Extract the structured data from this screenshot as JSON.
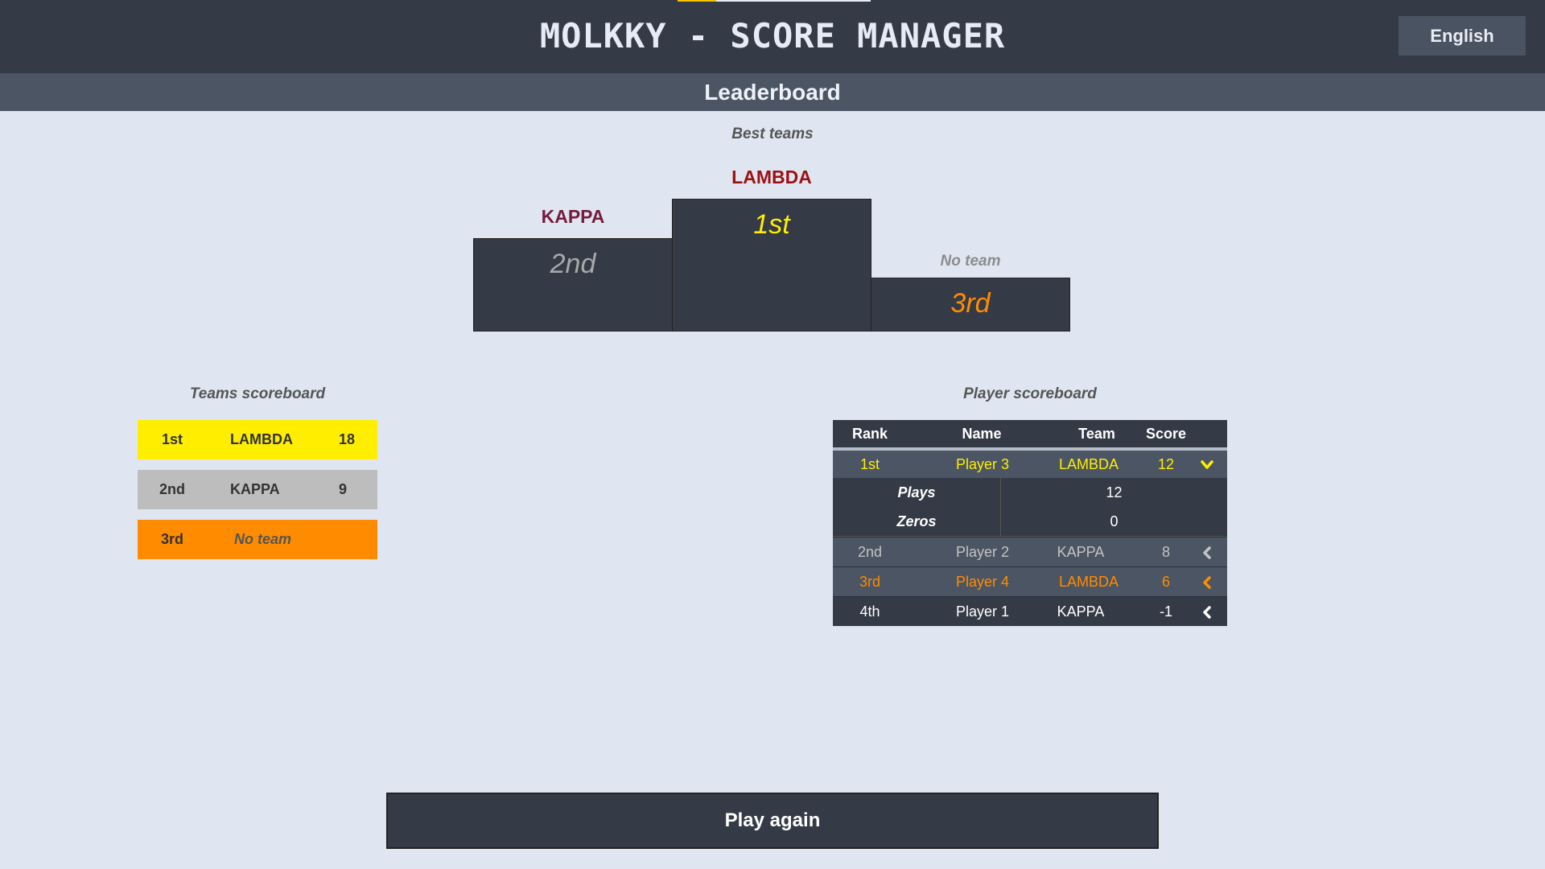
{
  "header": {
    "title": "MOLKKY - SCORE MANAGER",
    "language_label": "English"
  },
  "page": {
    "subtitle": "Leaderboard"
  },
  "podium": {
    "label": "Best teams",
    "first": {
      "team": "LAMBDA",
      "place": "1st"
    },
    "second": {
      "team": "KAPPA",
      "place": "2nd"
    },
    "third": {
      "team": "No team",
      "place": "3rd"
    }
  },
  "teams_scoreboard": {
    "label": "Teams scoreboard",
    "rows": [
      {
        "rank": "1st",
        "name": "LAMBDA",
        "score": "18"
      },
      {
        "rank": "2nd",
        "name": "KAPPA",
        "score": "9"
      },
      {
        "rank": "3rd",
        "name": "No team",
        "score": ""
      }
    ]
  },
  "player_scoreboard": {
    "label": "Player scoreboard",
    "columns": [
      "Rank",
      "Name",
      "Team",
      "Score"
    ],
    "rows": [
      {
        "rank": "1st",
        "name": "Player 3",
        "team": "LAMBDA",
        "score": "12",
        "expanded": true
      },
      {
        "rank": "2nd",
        "name": "Player 2",
        "team": "KAPPA",
        "score": "8",
        "expanded": false
      },
      {
        "rank": "3rd",
        "name": "Player 4",
        "team": "LAMBDA",
        "score": "6",
        "expanded": false
      },
      {
        "rank": "4th",
        "name": "Player 1",
        "team": "KAPPA",
        "score": "-1",
        "expanded": false
      }
    ],
    "details": {
      "plays_label": "Plays",
      "plays_value": "12",
      "zeros_label": "Zeros",
      "zeros_value": "0"
    }
  },
  "footer": {
    "play_again_label": "Play again"
  },
  "colors": {
    "gold": "#ffee00",
    "silver": "#bdbdbd",
    "bronze": "#ff8c00",
    "dark": "#343a46"
  },
  "icons": {
    "expanded": "chevron-down-icon",
    "collapsed": "chevron-left-icon"
  }
}
